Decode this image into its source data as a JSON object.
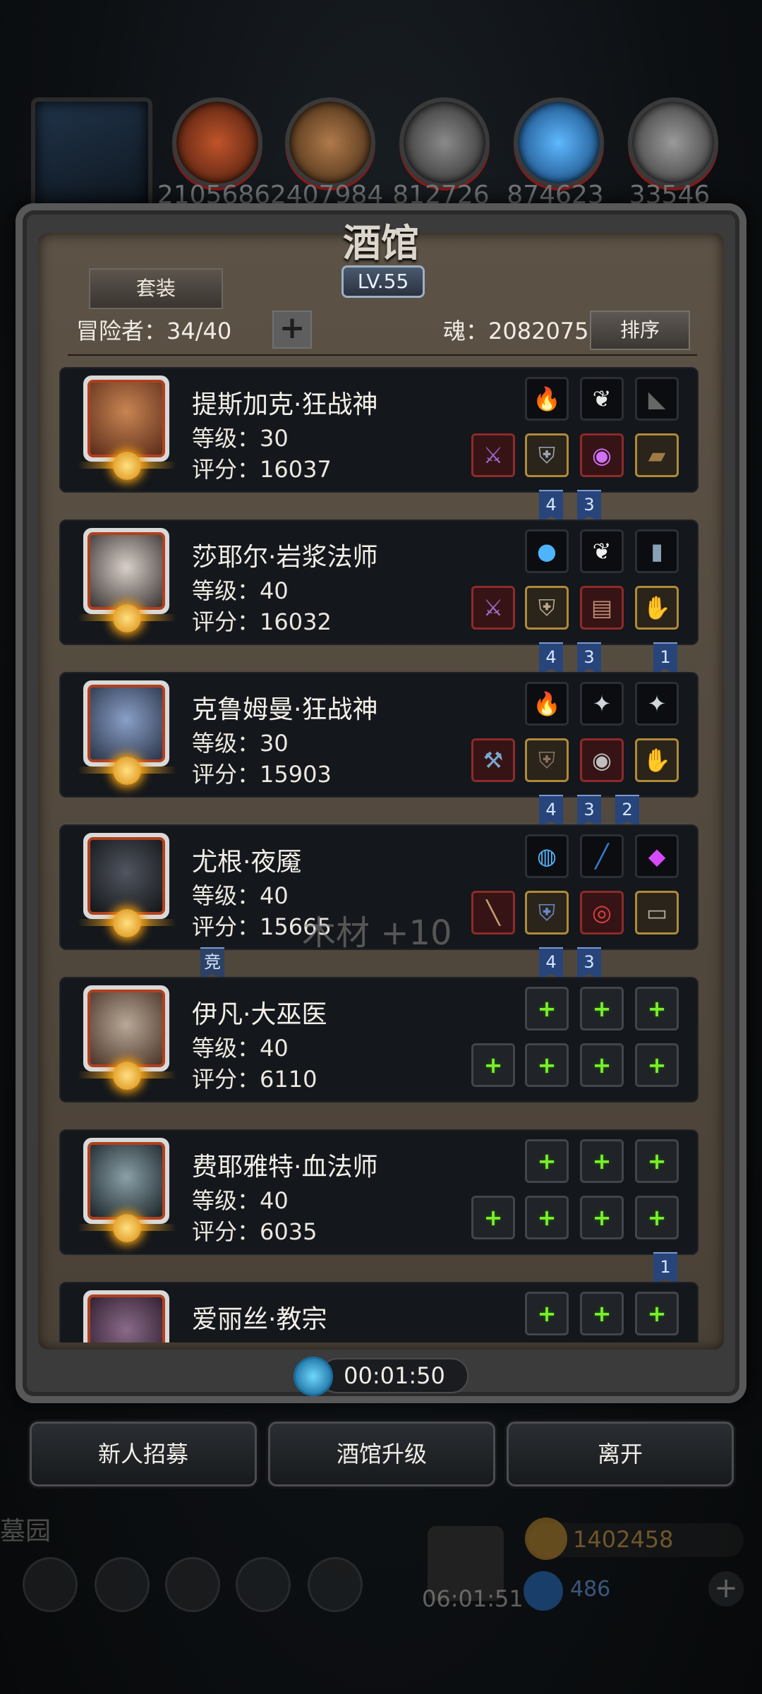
{
  "top_resources": [
    {
      "icon": "meat-icon",
      "value": "2105686"
    },
    {
      "icon": "wood-icon",
      "value": "2407984"
    },
    {
      "icon": "iron-icon",
      "value": "812726"
    },
    {
      "icon": "crystal-icon",
      "value": "874623"
    },
    {
      "icon": "steel-icon",
      "value": "33546"
    }
  ],
  "panel": {
    "title": "酒馆",
    "level": "LV.55",
    "tab_suit": "套装",
    "adventurers_label": "冒险者：34/40",
    "add_label": "+",
    "soul_label": "魂：2082075",
    "sort_label": "排序"
  },
  "heroes": [
    {
      "name": "提斯加克·狂战神",
      "level": "等级：30",
      "score": "评分：16037"
    },
    {
      "name": "莎耶尔·岩浆法师",
      "level": "等级：40",
      "score": "评分：16032"
    },
    {
      "name": "克鲁姆曼·狂战神",
      "level": "等级：30",
      "score": "评分：15903"
    },
    {
      "name": "尤根·夜魇",
      "level": "等级：40",
      "score": "评分：15665"
    },
    {
      "name": "伊凡·大巫医",
      "level": "等级：40",
      "score": "评分：6110"
    },
    {
      "name": "费耶雅特·血法师",
      "level": "等级：40",
      "score": "评分：6035"
    },
    {
      "name": "爱丽丝·教宗",
      "level": "",
      "score": ""
    }
  ],
  "ribbons": {
    "r1a": "4",
    "r1b": "3",
    "r2a": "4",
    "r2b": "3",
    "r2c": "1",
    "r3a": "4",
    "r3b": "3",
    "r3c": "2",
    "r4comp": "竞",
    "r4a": "4",
    "r4b": "3",
    "r6c": "1"
  },
  "floating_text": "木材 +10",
  "timer": "00:01:50",
  "buttons": {
    "recruit": "新人招募",
    "upgrade": "酒馆升级",
    "leave": "离开"
  },
  "bottom": {
    "graveyard": "墓园",
    "gold": "1402458",
    "gems": "486",
    "gift_timer": "06:01:51",
    "add": "+"
  }
}
